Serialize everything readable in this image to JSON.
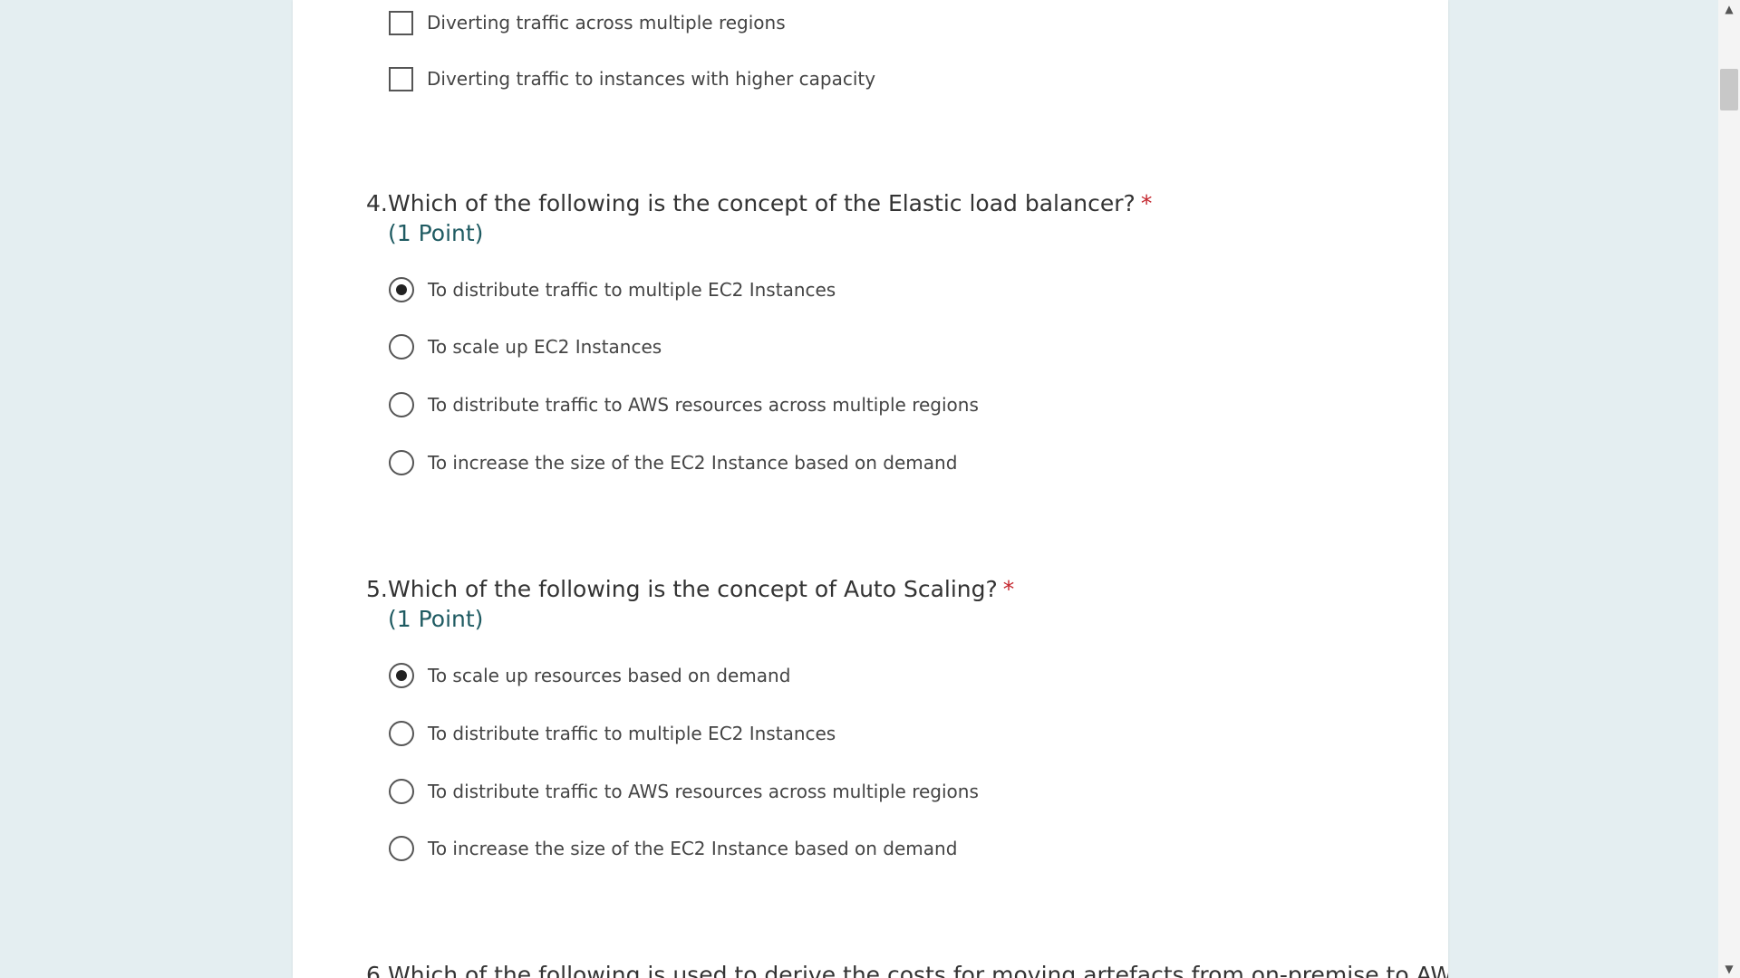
{
  "question3": {
    "options": [
      {
        "label": "Diverting traffic across multiple regions",
        "checked": false
      },
      {
        "label": "Diverting traffic to instances with higher capacity",
        "checked": false
      }
    ]
  },
  "question4": {
    "number": "4.",
    "text": "Which of the following is the concept of the Elastic load balancer?",
    "required_mark": "*",
    "points": "(1 Point)",
    "options": [
      {
        "label": "To distribute traffic to multiple EC2 Instances",
        "checked": true
      },
      {
        "label": "To scale up EC2 Instances",
        "checked": false
      },
      {
        "label": "To distribute traffic to AWS resources across multiple regions",
        "checked": false
      },
      {
        "label": "To increase the size of the EC2 Instance based on demand",
        "checked": false
      }
    ]
  },
  "question5": {
    "number": "5.",
    "text": "Which of the following is the concept of Auto Scaling?",
    "required_mark": "*",
    "points": "(1 Point)",
    "options": [
      {
        "label": "To scale up resources based on demand",
        "checked": true
      },
      {
        "label": "To distribute traffic to multiple EC2 Instances",
        "checked": false
      },
      {
        "label": "To distribute traffic to AWS resources across multiple regions",
        "checked": false
      },
      {
        "label": "To increase the size of the EC2 Instance based on demand",
        "checked": false
      }
    ]
  },
  "question6": {
    "number": "6.",
    "text": "Which of the following is used to derive the costs for moving artefacts from on-premise to AWS?"
  },
  "scrollbar": {
    "up_icon": "chevron-up-icon",
    "down_icon": "chevron-down-icon"
  },
  "colors": {
    "required": "#c4262e",
    "points": "#1f5b62",
    "background": "#e4eef1"
  }
}
